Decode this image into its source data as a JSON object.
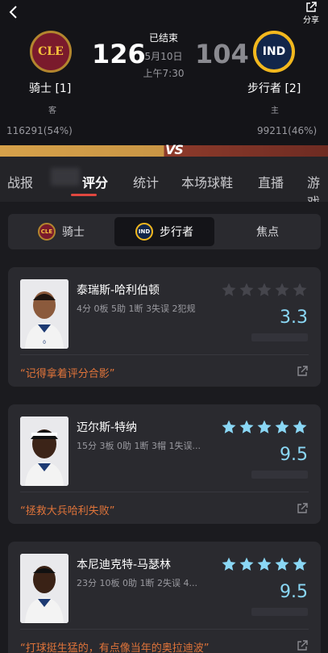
{
  "header": {
    "back_icon": "chevron-left-icon",
    "share_label": "分享",
    "share_icon": "share-out-icon",
    "home_team": {
      "name": "骑士 [1]",
      "logo_text": "CLE",
      "side": "客",
      "votes": "116291(54%)",
      "score": "126",
      "colors": {
        "primary": "#7a1a2c",
        "accent": "#b3862e"
      }
    },
    "away_team": {
      "name": "步行者 [2]",
      "logo_text": "IND",
      "side": "主",
      "votes": "99211(46%)",
      "score": "104",
      "colors": {
        "primary": "#12264a",
        "accent": "#f2b81e"
      }
    },
    "status": "已结束",
    "date": "5月10日",
    "time": "上午7:30",
    "vs_text": "VS"
  },
  "tabs": [
    {
      "label": "战报",
      "active": false
    },
    {
      "label": "评分",
      "active": true
    },
    {
      "label": "统计",
      "active": false
    },
    {
      "label": "本场球鞋",
      "active": false
    },
    {
      "label": "直播",
      "active": false
    },
    {
      "label": "游戏",
      "active": false
    }
  ],
  "segment": {
    "items": [
      {
        "label": "骑士",
        "logo": "CLE",
        "active": false
      },
      {
        "label": "步行者",
        "logo": "IND",
        "active": true
      },
      {
        "label": "焦点",
        "logo": "",
        "active": false
      }
    ]
  },
  "players": [
    {
      "name": "泰瑞斯-哈利伯顿",
      "stats": "4分 0板 5助 1断 3失误 2犯规",
      "rating": "3.3",
      "stars_filled": 0,
      "comment": "“记得拿着评分合影”"
    },
    {
      "name": "迈尔斯-特纳",
      "stats": "15分 3板 0助 1断 3帽 1失误...",
      "rating": "9.5",
      "stars_filled": 5,
      "comment": "“拯救大兵哈利失败”"
    },
    {
      "name": "本尼迪克特-马瑟林",
      "stats": "23分 10板 0助 1断 2失误 4...",
      "rating": "9.5",
      "stars_filled": 5,
      "comment": "“打球挺生猛的，有点像当年的奥拉迪波”"
    }
  ],
  "colors": {
    "accent_red": "#e0473f",
    "rating_blue": "#8ad7f5",
    "star_filled": "#8ad7f5",
    "star_empty": "#45454c",
    "comment_orange": "#e0743a"
  }
}
